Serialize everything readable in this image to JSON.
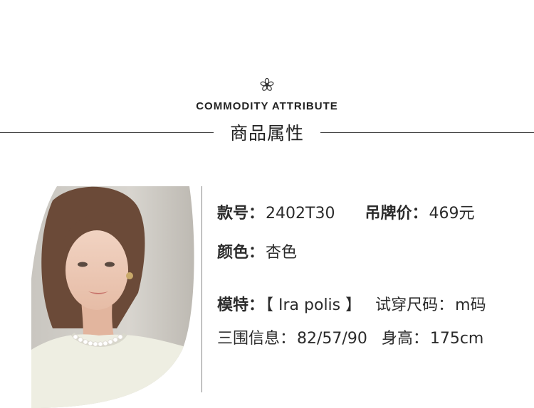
{
  "header": {
    "en_title": "COMMODITY ATTRIBUTE",
    "cn_title": "商品属性"
  },
  "attributes": {
    "style_no_label": "款号：",
    "style_no_value": "2402T30",
    "price_label": "吊牌价：",
    "price_value": "469元",
    "color_label": "颜色：",
    "color_value": "杏色",
    "model_label": "模特：",
    "model_value": "【 Ira polis 】",
    "size_label": "试穿尺码：",
    "size_value": "m码",
    "measure_label": "三围信息：",
    "measure_value": "82/57/90",
    "height_label": "身高：",
    "height_value": "175cm"
  }
}
